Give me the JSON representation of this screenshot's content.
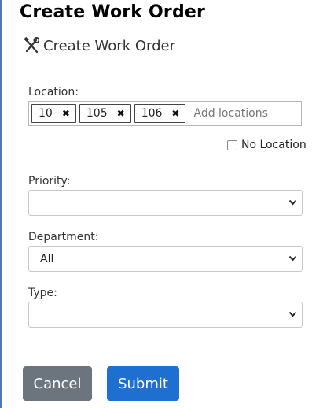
{
  "window": {
    "title": "Create Work Order"
  },
  "form": {
    "header": {
      "icon": "tools-icon",
      "title": "Create Work Order"
    },
    "location": {
      "label": "Location:",
      "tags": [
        {
          "label": "10",
          "remove_icon": "✖"
        },
        {
          "label": "105",
          "remove_icon": "✖"
        },
        {
          "label": "106",
          "remove_icon": "✖"
        }
      ],
      "placeholder": "Add locations",
      "no_location": {
        "label": "No Location",
        "checked": false
      }
    },
    "priority": {
      "label": "Priority:",
      "value": ""
    },
    "department": {
      "label": "Department:",
      "value": "All"
    },
    "type": {
      "label": "Type:",
      "value": ""
    }
  },
  "actions": {
    "cancel_label": "Cancel",
    "submit_label": "Submit"
  },
  "colors": {
    "cancel": "#6c757d",
    "submit": "#1f6fd0",
    "accent_rule": "#4a78b8"
  }
}
